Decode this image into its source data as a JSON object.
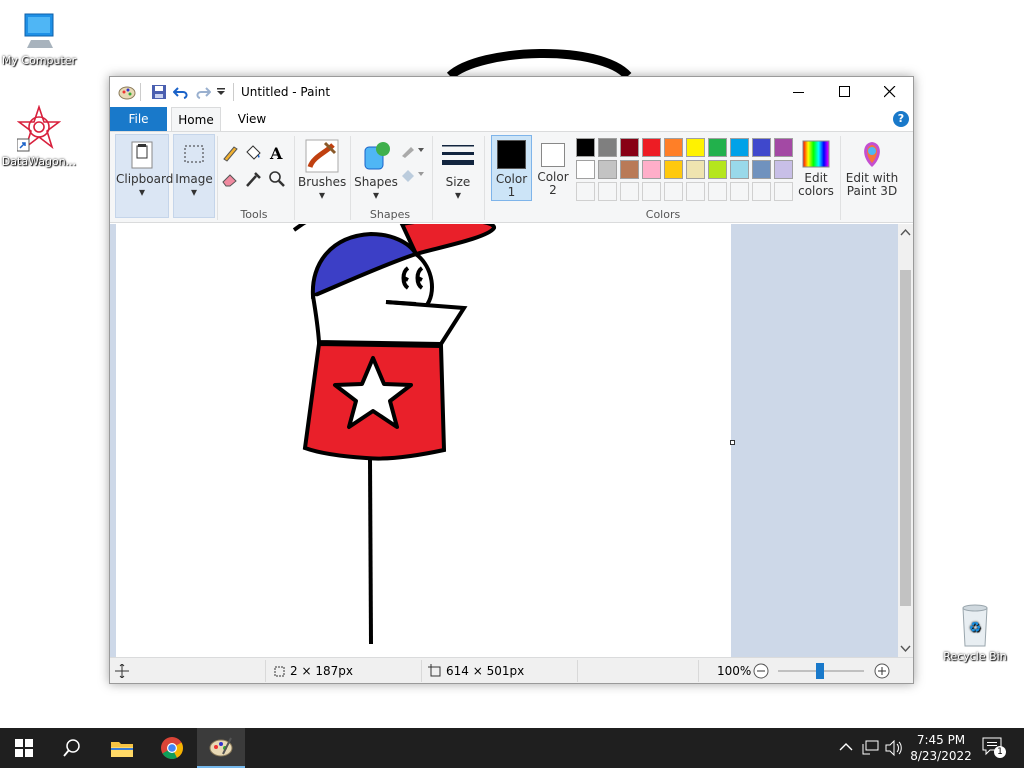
{
  "desktop": {
    "icons": [
      {
        "label": "My Computer",
        "icon": "monitor-icon"
      },
      {
        "label": "DataWagon...",
        "icon": "datawagon-logo-icon"
      },
      {
        "label": "Recycle Bin",
        "icon": "recycle-bin-icon"
      }
    ]
  },
  "window": {
    "title": "Untitled - Paint",
    "quick_access": [
      "paint-app-icon",
      "save-icon",
      "undo-icon",
      "redo-icon",
      "customize-dropdown-icon"
    ],
    "controls": [
      "minimize-icon",
      "maximize-icon",
      "close-icon"
    ]
  },
  "ribbon_tabs": [
    "File",
    "Home",
    "View"
  ],
  "ribbon": {
    "clipboard_label": "Clipboard",
    "image_label": "Image",
    "tools_label": "Tools",
    "brushes_label": "Brushes",
    "shapes_button_label": "Shapes",
    "shapes_group_label": "Shapes",
    "size_label": "Size",
    "color1_label": "Color",
    "color1_num": "1",
    "color2_label": "Color",
    "color2_num": "2",
    "colors_group_label": "Colors",
    "edit_colors_label": "Edit",
    "edit_colors_label2": "colors",
    "paint3d_label": "Edit with",
    "paint3d_label2": "Paint 3D",
    "color1_value": "#000000",
    "color2_value": "#ffffff",
    "palette_row1": [
      "#000000",
      "#7f7f7f",
      "#880015",
      "#ed1c24",
      "#ff7f27",
      "#fff200",
      "#22b14c",
      "#00a2e8",
      "#3f48cc",
      "#a349a4"
    ],
    "palette_row2": [
      "#ffffff",
      "#c3c3c3",
      "#b97a57",
      "#ffaec9",
      "#ffc90e",
      "#efe4b0",
      "#b5e61d",
      "#99d9ea",
      "#7092be",
      "#c8bfe7"
    ]
  },
  "status": {
    "selection_size": "2 × 187px",
    "canvas_size": "614 × 501px",
    "zoom": "100%"
  },
  "taskbar": {
    "time": "7:45 PM",
    "date": "8/23/2022",
    "notification_count": "1",
    "pinned": [
      "start-icon",
      "search-icon",
      "file-explorer-icon",
      "chrome-icon",
      "paint-taskbar-icon"
    ]
  }
}
